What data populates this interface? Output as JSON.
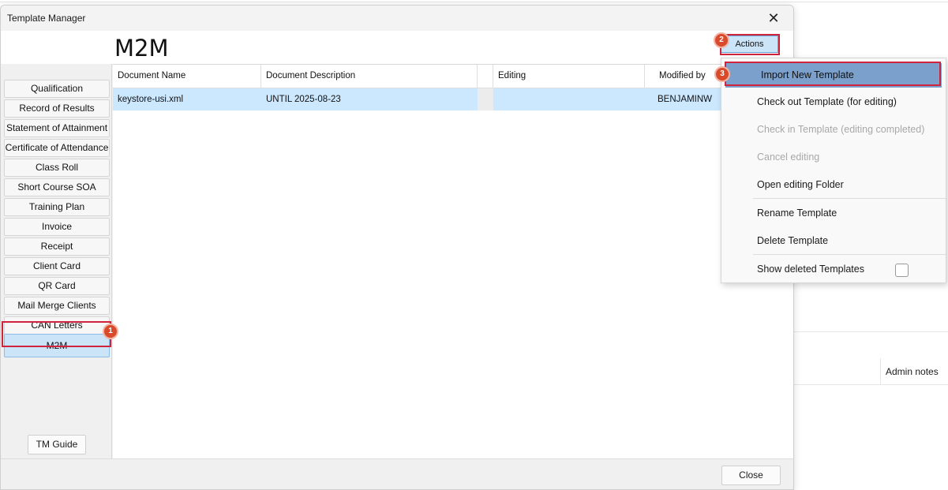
{
  "background": {
    "admin_notes_label": "Admin notes"
  },
  "window": {
    "title": "Template Manager",
    "close_glyph": "✕"
  },
  "heading": "M2M",
  "actions_label": "Actions",
  "sidebar": {
    "items": [
      {
        "label": "Qualification"
      },
      {
        "label": "Record of Results"
      },
      {
        "label": "Statement of Attainment"
      },
      {
        "label": "Certificate of Attendance"
      },
      {
        "label": "Class Roll"
      },
      {
        "label": "Short Course SOA"
      },
      {
        "label": "Training Plan"
      },
      {
        "label": "Invoice"
      },
      {
        "label": "Receipt"
      },
      {
        "label": "Client Card"
      },
      {
        "label": "QR Card"
      },
      {
        "label": "Mail Merge Clients"
      },
      {
        "label": "CAN Letters"
      },
      {
        "label": "M2M",
        "selected": true
      }
    ],
    "guide_label": "TM Guide"
  },
  "table": {
    "columns": [
      "Document Name",
      "Document Description",
      "",
      "Editing",
      "Modified by"
    ],
    "rows": [
      {
        "name": "keystore-usi.xml",
        "description": "UNTIL 2025-08-23",
        "editing": "",
        "modified_by": "BENJAMINW"
      }
    ]
  },
  "footer": {
    "close_label": "Close"
  },
  "menu": {
    "items": [
      {
        "label": "Import New Template",
        "enabled": true,
        "selected": true
      },
      {
        "label": "Check out Template (for editing)",
        "enabled": true
      },
      {
        "label": "Check in Template (editing completed)",
        "enabled": false
      },
      {
        "label": "Cancel editing",
        "enabled": false
      },
      {
        "label": "Open editing Folder",
        "enabled": true
      },
      {
        "label": "Rename Template",
        "enabled": true
      },
      {
        "label": "Delete Template",
        "enabled": true
      },
      {
        "label": "Show deleted Templates",
        "enabled": true,
        "checkbox": false
      }
    ]
  },
  "annotations": {
    "badges": [
      "1",
      "2",
      "3"
    ],
    "highlight_color": "#d0243c",
    "badge_color": "#d84a2b"
  },
  "colors": {
    "selection": "#cce8ff",
    "menu_selected": "#7ba0cc",
    "active_tab": "#cce4f7"
  }
}
